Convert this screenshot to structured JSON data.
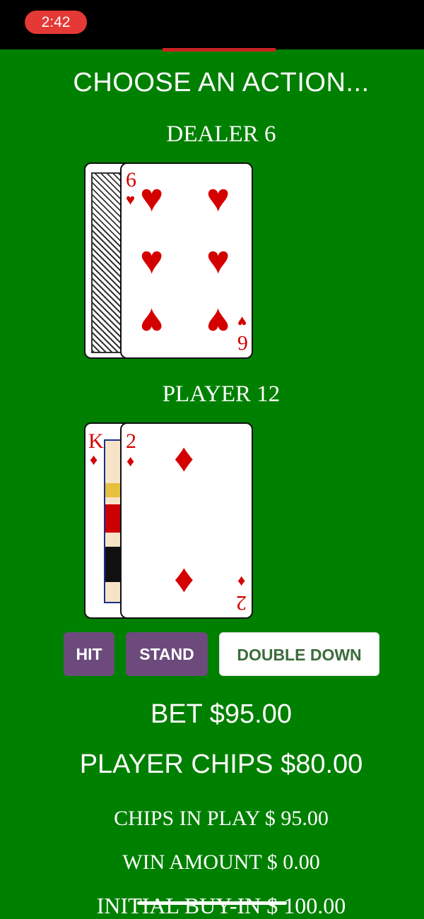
{
  "status": {
    "time": "2:42"
  },
  "header": {
    "title": "CHOOSE AN ACTION..."
  },
  "dealer": {
    "label": "DEALER 6",
    "cards": [
      {
        "face": "back"
      },
      {
        "rank": "6",
        "suit": "hearts",
        "suit_symbol": "♥"
      }
    ]
  },
  "player": {
    "label": "PLAYER 12",
    "cards": [
      {
        "rank": "K",
        "suit": "diamonds",
        "suit_symbol": "♦"
      },
      {
        "rank": "2",
        "suit": "diamonds",
        "suit_symbol": "♦"
      }
    ]
  },
  "actions": {
    "hit": "HIT",
    "stand": "STAND",
    "double_down": "DOUBLE DOWN"
  },
  "stats": {
    "bet": "BET $95.00",
    "player_chips": "PLAYER CHIPS $80.00",
    "chips_in_play": "CHIPS IN PLAY $ 95.00",
    "win_amount": "WIN AMOUNT $ 0.00",
    "initial_buy_in": "INITIAL BUY-IN $ 100.00"
  },
  "colors": {
    "table_green": "#008000",
    "card_red": "#d40000",
    "button_purple": "#6c4b7c",
    "time_pill_red": "#e53935"
  }
}
